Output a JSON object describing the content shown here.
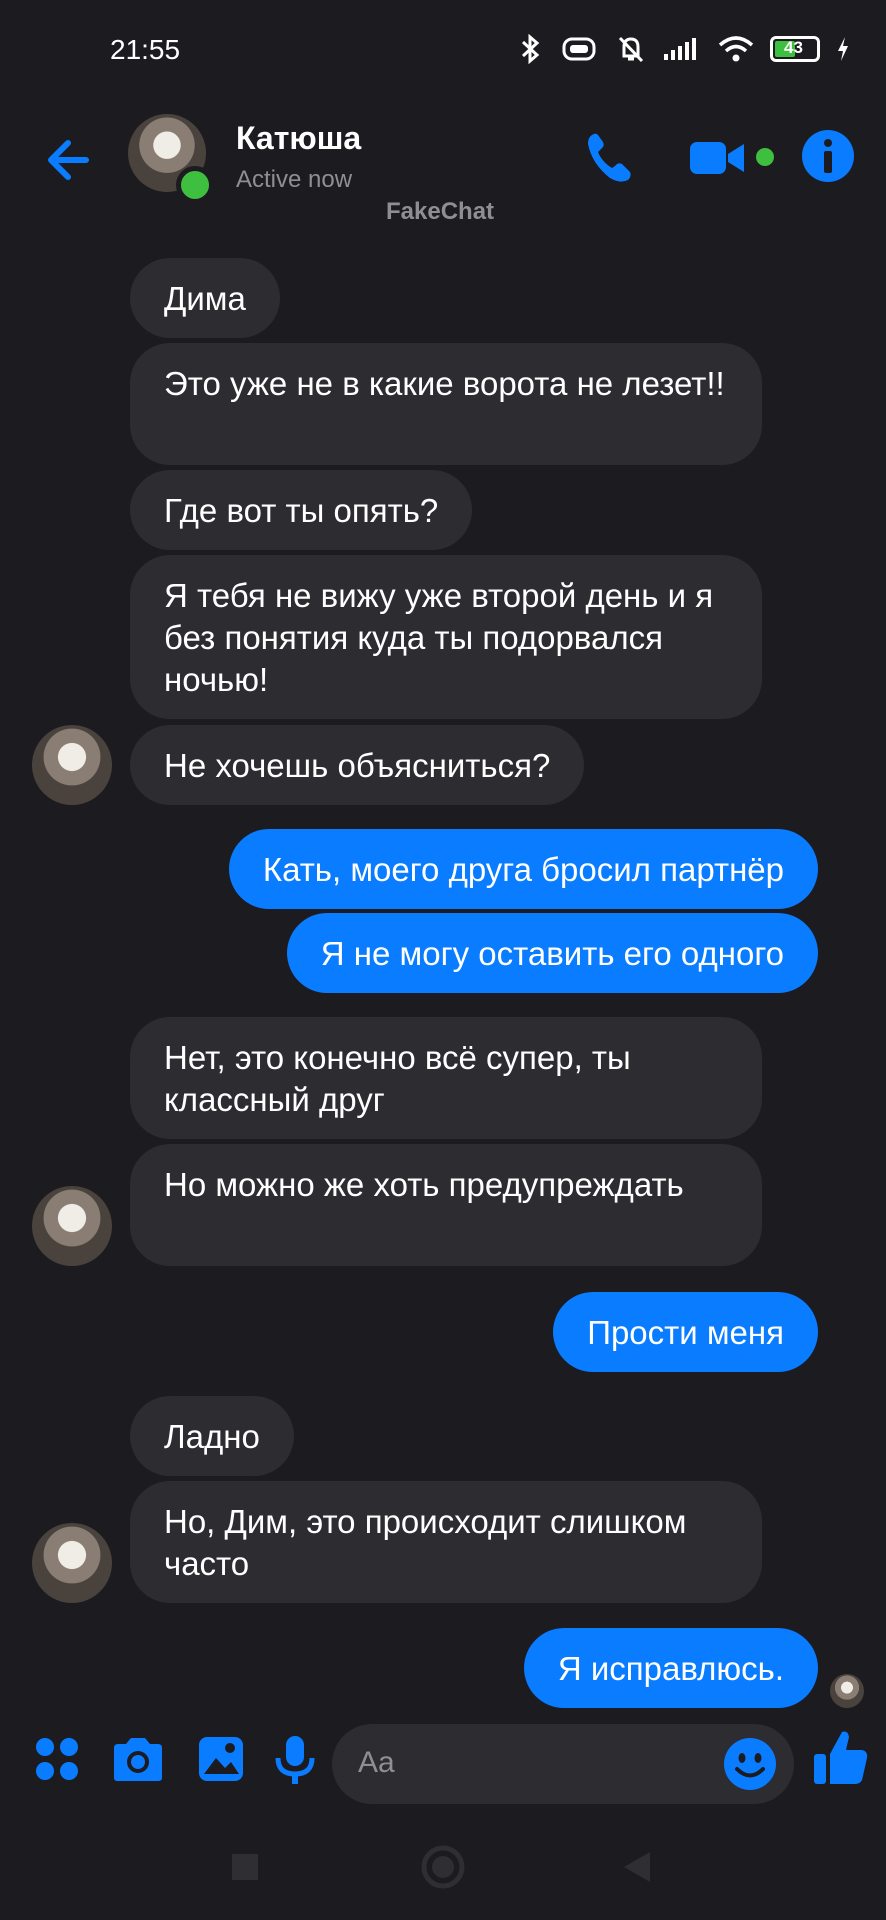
{
  "status_bar": {
    "time": "21:55",
    "battery": "43"
  },
  "header": {
    "contact_name": "Катюша",
    "contact_status": "Active now",
    "watermark": "FakeChat"
  },
  "messages": [
    {
      "side": "in",
      "text": "Дима"
    },
    {
      "side": "in",
      "text": "Это уже не в какие ворота не лезет!!"
    },
    {
      "side": "in",
      "text": "Где вот ты опять?"
    },
    {
      "side": "in",
      "text": "Я тебя не вижу уже второй день и я без понятия куда ты подорвался ночью!"
    },
    {
      "side": "in",
      "text": "Не хочешь объясниться?"
    },
    {
      "side": "out",
      "text": "Кать, моего друга бросил партнёр"
    },
    {
      "side": "out",
      "text": "Я не могу оставить его одного"
    },
    {
      "side": "in",
      "text": "Нет, это конечно всё супер, ты классный друг"
    },
    {
      "side": "in",
      "text": "Но можно же хоть предупреждать"
    },
    {
      "side": "out",
      "text": "Прости меня"
    },
    {
      "side": "in",
      "text": "Ладно"
    },
    {
      "side": "in",
      "text": "Но, Дим, это происходит слишком часто"
    },
    {
      "side": "out",
      "text": "Я исправлюсь."
    }
  ],
  "composer": {
    "placeholder": "Aa"
  },
  "colors": {
    "accent": "#0a7cff",
    "incoming_bubble": "#2d2c31",
    "background": "#1c1b20",
    "online": "#3fbf3f"
  }
}
